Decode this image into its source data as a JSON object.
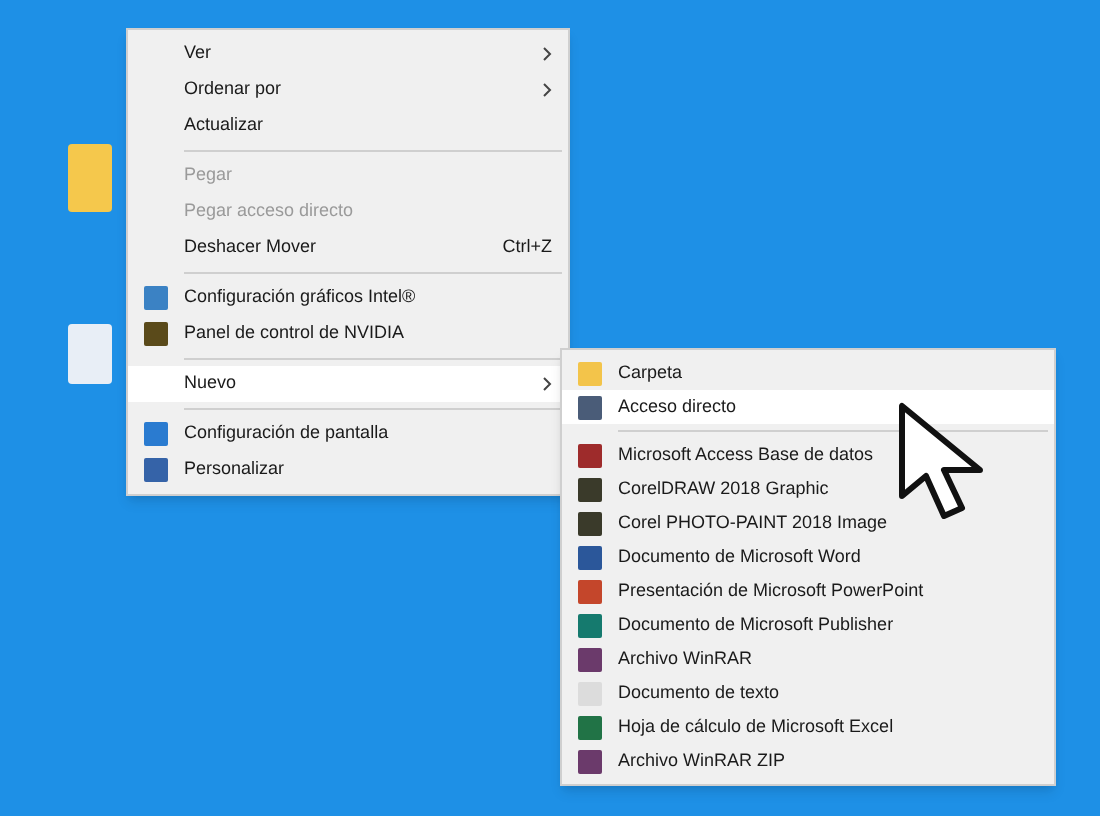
{
  "context_menu": {
    "items": [
      {
        "kind": "item",
        "label": "Ver",
        "submenu": true,
        "disabled": false,
        "selected": false
      },
      {
        "kind": "item",
        "label": "Ordenar por",
        "submenu": true,
        "disabled": false,
        "selected": false
      },
      {
        "kind": "item",
        "label": "Actualizar",
        "submenu": false,
        "disabled": false,
        "selected": false
      },
      {
        "kind": "separator"
      },
      {
        "kind": "item",
        "label": "Pegar",
        "submenu": false,
        "disabled": true,
        "selected": false
      },
      {
        "kind": "item",
        "label": "Pegar acceso directo",
        "submenu": false,
        "disabled": true,
        "selected": false
      },
      {
        "kind": "item",
        "label": "Deshacer Mover",
        "shortcut": "Ctrl+Z",
        "submenu": false,
        "disabled": false,
        "selected": false
      },
      {
        "kind": "separator"
      },
      {
        "kind": "item",
        "label": "Configuración gráficos Intel®",
        "submenu": false,
        "disabled": false,
        "selected": false
      },
      {
        "kind": "item",
        "label": "Panel de control de NVIDIA",
        "submenu": false,
        "disabled": false,
        "selected": false
      },
      {
        "kind": "separator"
      },
      {
        "kind": "item",
        "label": "Nuevo",
        "submenu": true,
        "disabled": false,
        "selected": true
      },
      {
        "kind": "separator"
      },
      {
        "kind": "item",
        "label": "Configuración de pantalla",
        "submenu": false,
        "disabled": false,
        "selected": false
      },
      {
        "kind": "item",
        "label": "Personalizar",
        "submenu": false,
        "disabled": false,
        "selected": false
      }
    ]
  },
  "new_submenu": {
    "items": [
      {
        "kind": "item",
        "label": "Carpeta",
        "selected": false
      },
      {
        "kind": "item",
        "label": "Acceso directo",
        "selected": true
      },
      {
        "kind": "separator"
      },
      {
        "kind": "item",
        "label": "Microsoft Access Base de datos",
        "selected": false
      },
      {
        "kind": "item",
        "label": "CorelDRAW 2018 Graphic",
        "selected": false
      },
      {
        "kind": "item",
        "label": "Corel PHOTO-PAINT 2018 Image",
        "selected": false
      },
      {
        "kind": "item",
        "label": "Documento de Microsoft Word",
        "selected": false
      },
      {
        "kind": "item",
        "label": "Presentación de Microsoft PowerPoint",
        "selected": false
      },
      {
        "kind": "item",
        "label": "Documento de Microsoft Publisher",
        "selected": false
      },
      {
        "kind": "item",
        "label": "Archivo WinRAR",
        "selected": false
      },
      {
        "kind": "item",
        "label": "Documento de texto",
        "selected": false
      },
      {
        "kind": "item",
        "label": "Hoja de cálculo de Microsoft Excel",
        "selected": false
      },
      {
        "kind": "item",
        "label": "Archivo WinRAR ZIP",
        "selected": false
      }
    ]
  }
}
